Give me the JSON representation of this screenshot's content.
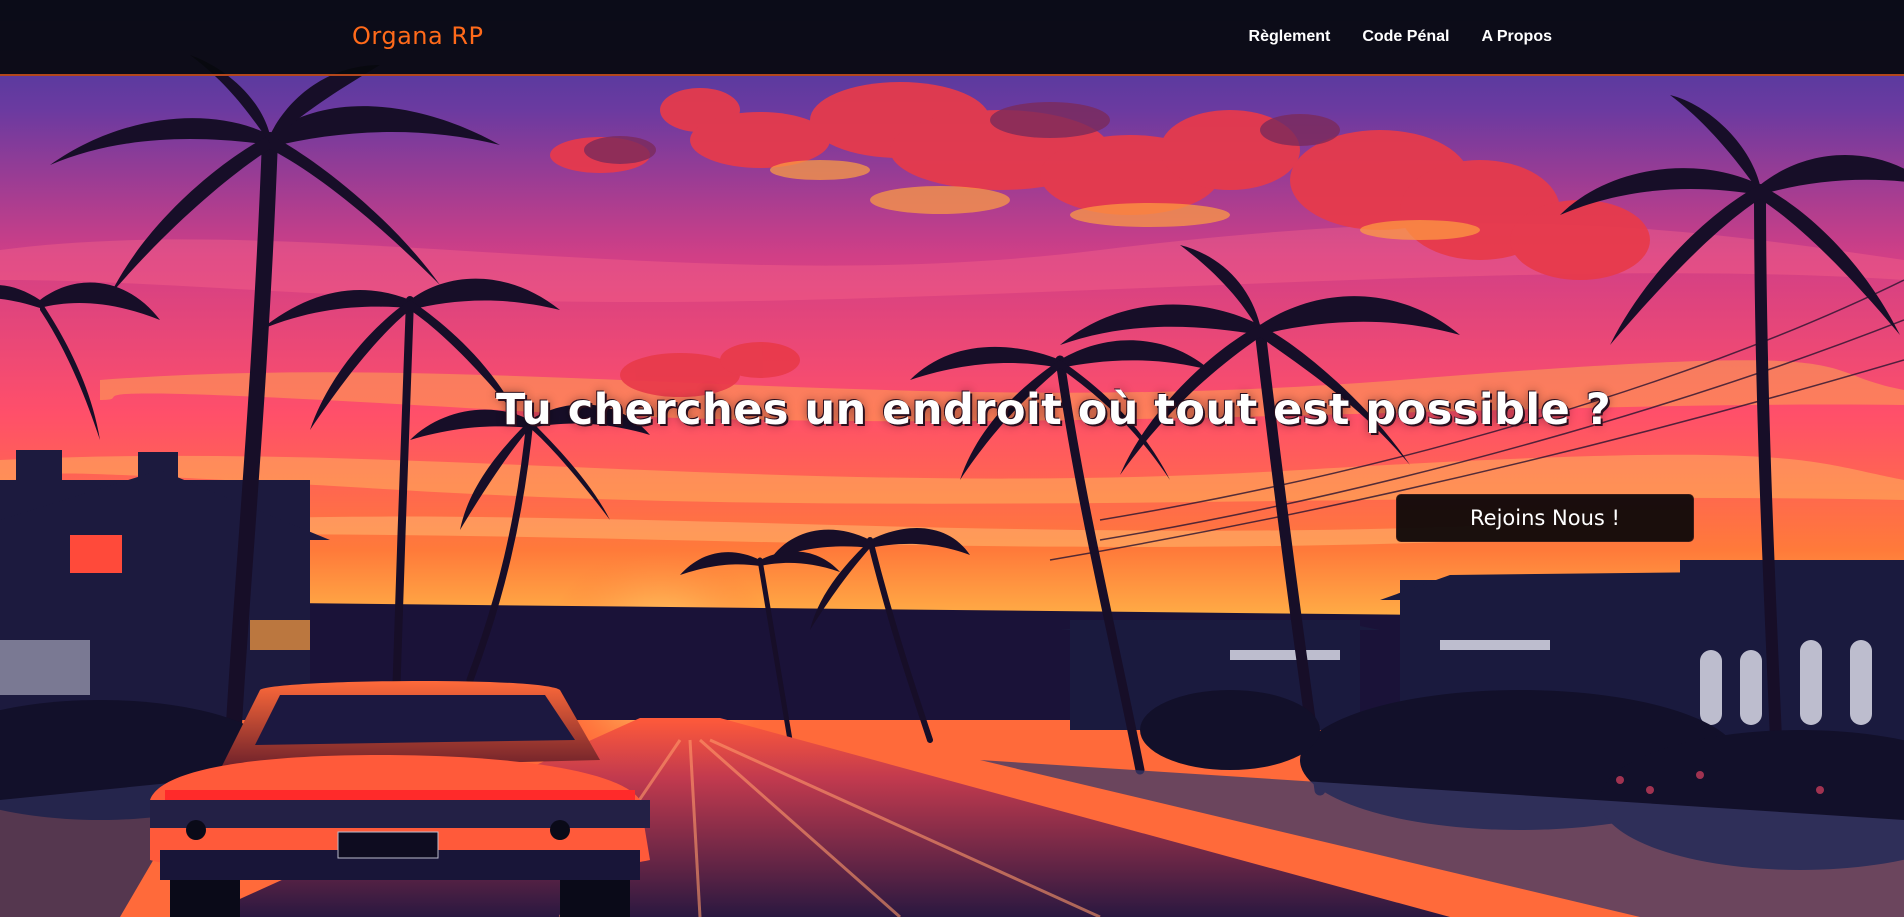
{
  "navbar": {
    "brand": "Organa RP",
    "links": [
      {
        "label": "Règlement"
      },
      {
        "label": "Code Pénal"
      },
      {
        "label": "A Propos"
      }
    ]
  },
  "hero": {
    "headline": "Tu cherches un endroit où tout est possible ?",
    "cta_label": "Rejoins Nous !"
  },
  "colors": {
    "brand_accent": "#ff6a1a",
    "navbar_bg": "#08090e",
    "navbar_border": "#b3471c",
    "cta_bg": "#0e080a",
    "sky_top": "#3b3a9a",
    "sky_mid": "#e8436e",
    "sky_horizon": "#ff8a2a"
  }
}
